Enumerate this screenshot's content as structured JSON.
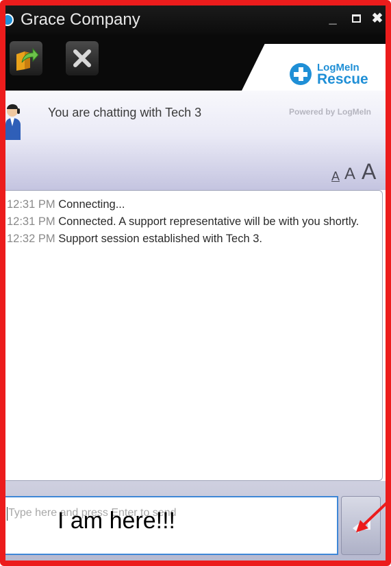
{
  "window": {
    "title": "Grace Company"
  },
  "window_controls": {
    "minimize": "_",
    "close": "✖"
  },
  "toolbar": {
    "transfer_icon": "transfer-icon",
    "end_session_icon": "close-x-icon"
  },
  "brand": {
    "logo_top": "LogMeIn",
    "logo_bottom": "Rescue",
    "powered_by": "Powered by LogMeIn",
    "accent_color": "#1f8fd6"
  },
  "header": {
    "status": "You are chatting with Tech 3"
  },
  "font_size_controls": {
    "small": "A",
    "medium": "A",
    "large": "A"
  },
  "transcript": [
    {
      "time": "12:31 PM",
      "text": "Connecting..."
    },
    {
      "time": "12:31 PM",
      "text": "Connected. A support representative will be with you shortly."
    },
    {
      "time": "12:32 PM",
      "text": "Support session established with Tech 3."
    }
  ],
  "input": {
    "placeholder": "Type here and press Enter to send",
    "value": ""
  },
  "annotation": {
    "text": "I am here!!!",
    "color": "#ec1c1c"
  }
}
